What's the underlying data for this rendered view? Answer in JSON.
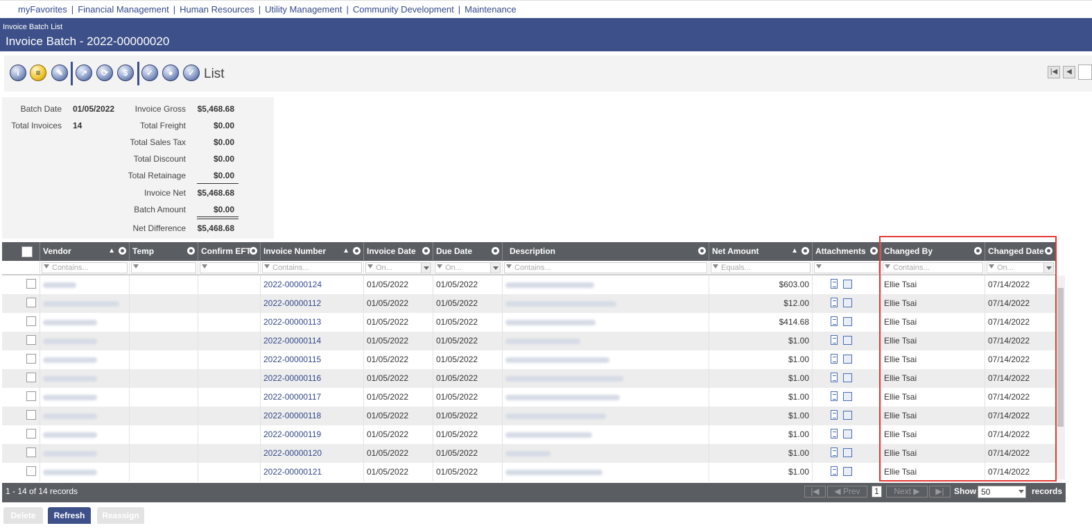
{
  "topnav": {
    "links": [
      "myFavorites",
      "Financial Management",
      "Human Resources",
      "Utility Management",
      "Community Development",
      "Maintenance"
    ],
    "separator": "|"
  },
  "header": {
    "breadcrumb": "Invoice Batch List",
    "title": "Invoice Batch - 2022-00000020"
  },
  "toolbar": {
    "icons": [
      "info-icon",
      "batch-icon",
      "edit-icon",
      "post-icon",
      "refresh-icon",
      "payment-icon",
      "approve-icon",
      "drop-icon",
      "check-icon"
    ],
    "view_label": "List"
  },
  "summary": {
    "batch_date_label": "Batch Date",
    "batch_date": "01/05/2022",
    "total_invoices_label": "Total Invoices",
    "total_invoices": "14",
    "invoice_gross_label": "Invoice Gross",
    "invoice_gross": "$5,468.68",
    "total_freight_label": "Total Freight",
    "total_freight": "$0.00",
    "total_sales_tax_label": "Total Sales Tax",
    "total_sales_tax": "$0.00",
    "total_discount_label": "Total Discount",
    "total_discount": "$0.00",
    "total_retainage_label": "Total Retainage",
    "total_retainage": "$0.00",
    "invoice_net_label": "Invoice Net",
    "invoice_net": "$5,468.68",
    "batch_amount_label": "Batch Amount",
    "batch_amount": "$0.00",
    "net_difference_label": "Net Difference",
    "net_difference": "$5,468.68"
  },
  "grid": {
    "columns": {
      "vendor": "Vendor",
      "temp": "Temp",
      "confirm_eft": "Confirm EFT",
      "invoice_number": "Invoice Number",
      "invoice_date": "Invoice Date",
      "due_date": "Due Date",
      "description": "Description",
      "net_amount": "Net Amount",
      "attachments": "Attachments",
      "changed_by": "Changed By",
      "changed_date": "Changed Date"
    },
    "filters": {
      "contains": "Contains...",
      "on": "On...",
      "equals": "Equals..."
    },
    "rows": [
      {
        "invoice_number": "2022-00000124",
        "invoice_date": "01/05/2022",
        "due_date": "01/05/2022",
        "net_amount": "$603.00",
        "changed_by": "Ellie Tsai",
        "changed_date": "07/14/2022"
      },
      {
        "invoice_number": "2022-00000112",
        "invoice_date": "01/05/2022",
        "due_date": "01/05/2022",
        "net_amount": "$12.00",
        "changed_by": "Ellie Tsai",
        "changed_date": "07/14/2022"
      },
      {
        "invoice_number": "2022-00000113",
        "invoice_date": "01/05/2022",
        "due_date": "01/05/2022",
        "net_amount": "$414.68",
        "changed_by": "Ellie Tsai",
        "changed_date": "07/14/2022"
      },
      {
        "invoice_number": "2022-00000114",
        "invoice_date": "01/05/2022",
        "due_date": "01/05/2022",
        "net_amount": "$1.00",
        "changed_by": "Ellie Tsai",
        "changed_date": "07/14/2022"
      },
      {
        "invoice_number": "2022-00000115",
        "invoice_date": "01/05/2022",
        "due_date": "01/05/2022",
        "net_amount": "$1.00",
        "changed_by": "Ellie Tsai",
        "changed_date": "07/14/2022"
      },
      {
        "invoice_number": "2022-00000116",
        "invoice_date": "01/05/2022",
        "due_date": "01/05/2022",
        "net_amount": "$1.00",
        "changed_by": "Ellie Tsai",
        "changed_date": "07/14/2022"
      },
      {
        "invoice_number": "2022-00000117",
        "invoice_date": "01/05/2022",
        "due_date": "01/05/2022",
        "net_amount": "$1.00",
        "changed_by": "Ellie Tsai",
        "changed_date": "07/14/2022"
      },
      {
        "invoice_number": "2022-00000118",
        "invoice_date": "01/05/2022",
        "due_date": "01/05/2022",
        "net_amount": "$1.00",
        "changed_by": "Ellie Tsai",
        "changed_date": "07/14/2022"
      },
      {
        "invoice_number": "2022-00000119",
        "invoice_date": "01/05/2022",
        "due_date": "01/05/2022",
        "net_amount": "$1.00",
        "changed_by": "Ellie Tsai",
        "changed_date": "07/14/2022"
      },
      {
        "invoice_number": "2022-00000120",
        "invoice_date": "01/05/2022",
        "due_date": "01/05/2022",
        "net_amount": "$1.00",
        "changed_by": "Ellie Tsai",
        "changed_date": "07/14/2022"
      },
      {
        "invoice_number": "2022-00000121",
        "invoice_date": "01/05/2022",
        "due_date": "01/05/2022",
        "net_amount": "$1.00",
        "changed_by": "Ellie Tsai",
        "changed_date": "07/14/2022"
      }
    ]
  },
  "footer": {
    "records_text": "1 - 14 of 14 records",
    "prev_label": "Prev",
    "next_label": "Next",
    "current_page": "1",
    "show_label": "Show",
    "page_size": "50",
    "records_label": "records"
  },
  "buttons": {
    "delete": "Delete",
    "refresh": "Refresh",
    "reassign": "Reassign"
  },
  "colors": {
    "brand": "#3d5089",
    "grid_header": "#5a5d62",
    "highlight": "#e53935"
  }
}
